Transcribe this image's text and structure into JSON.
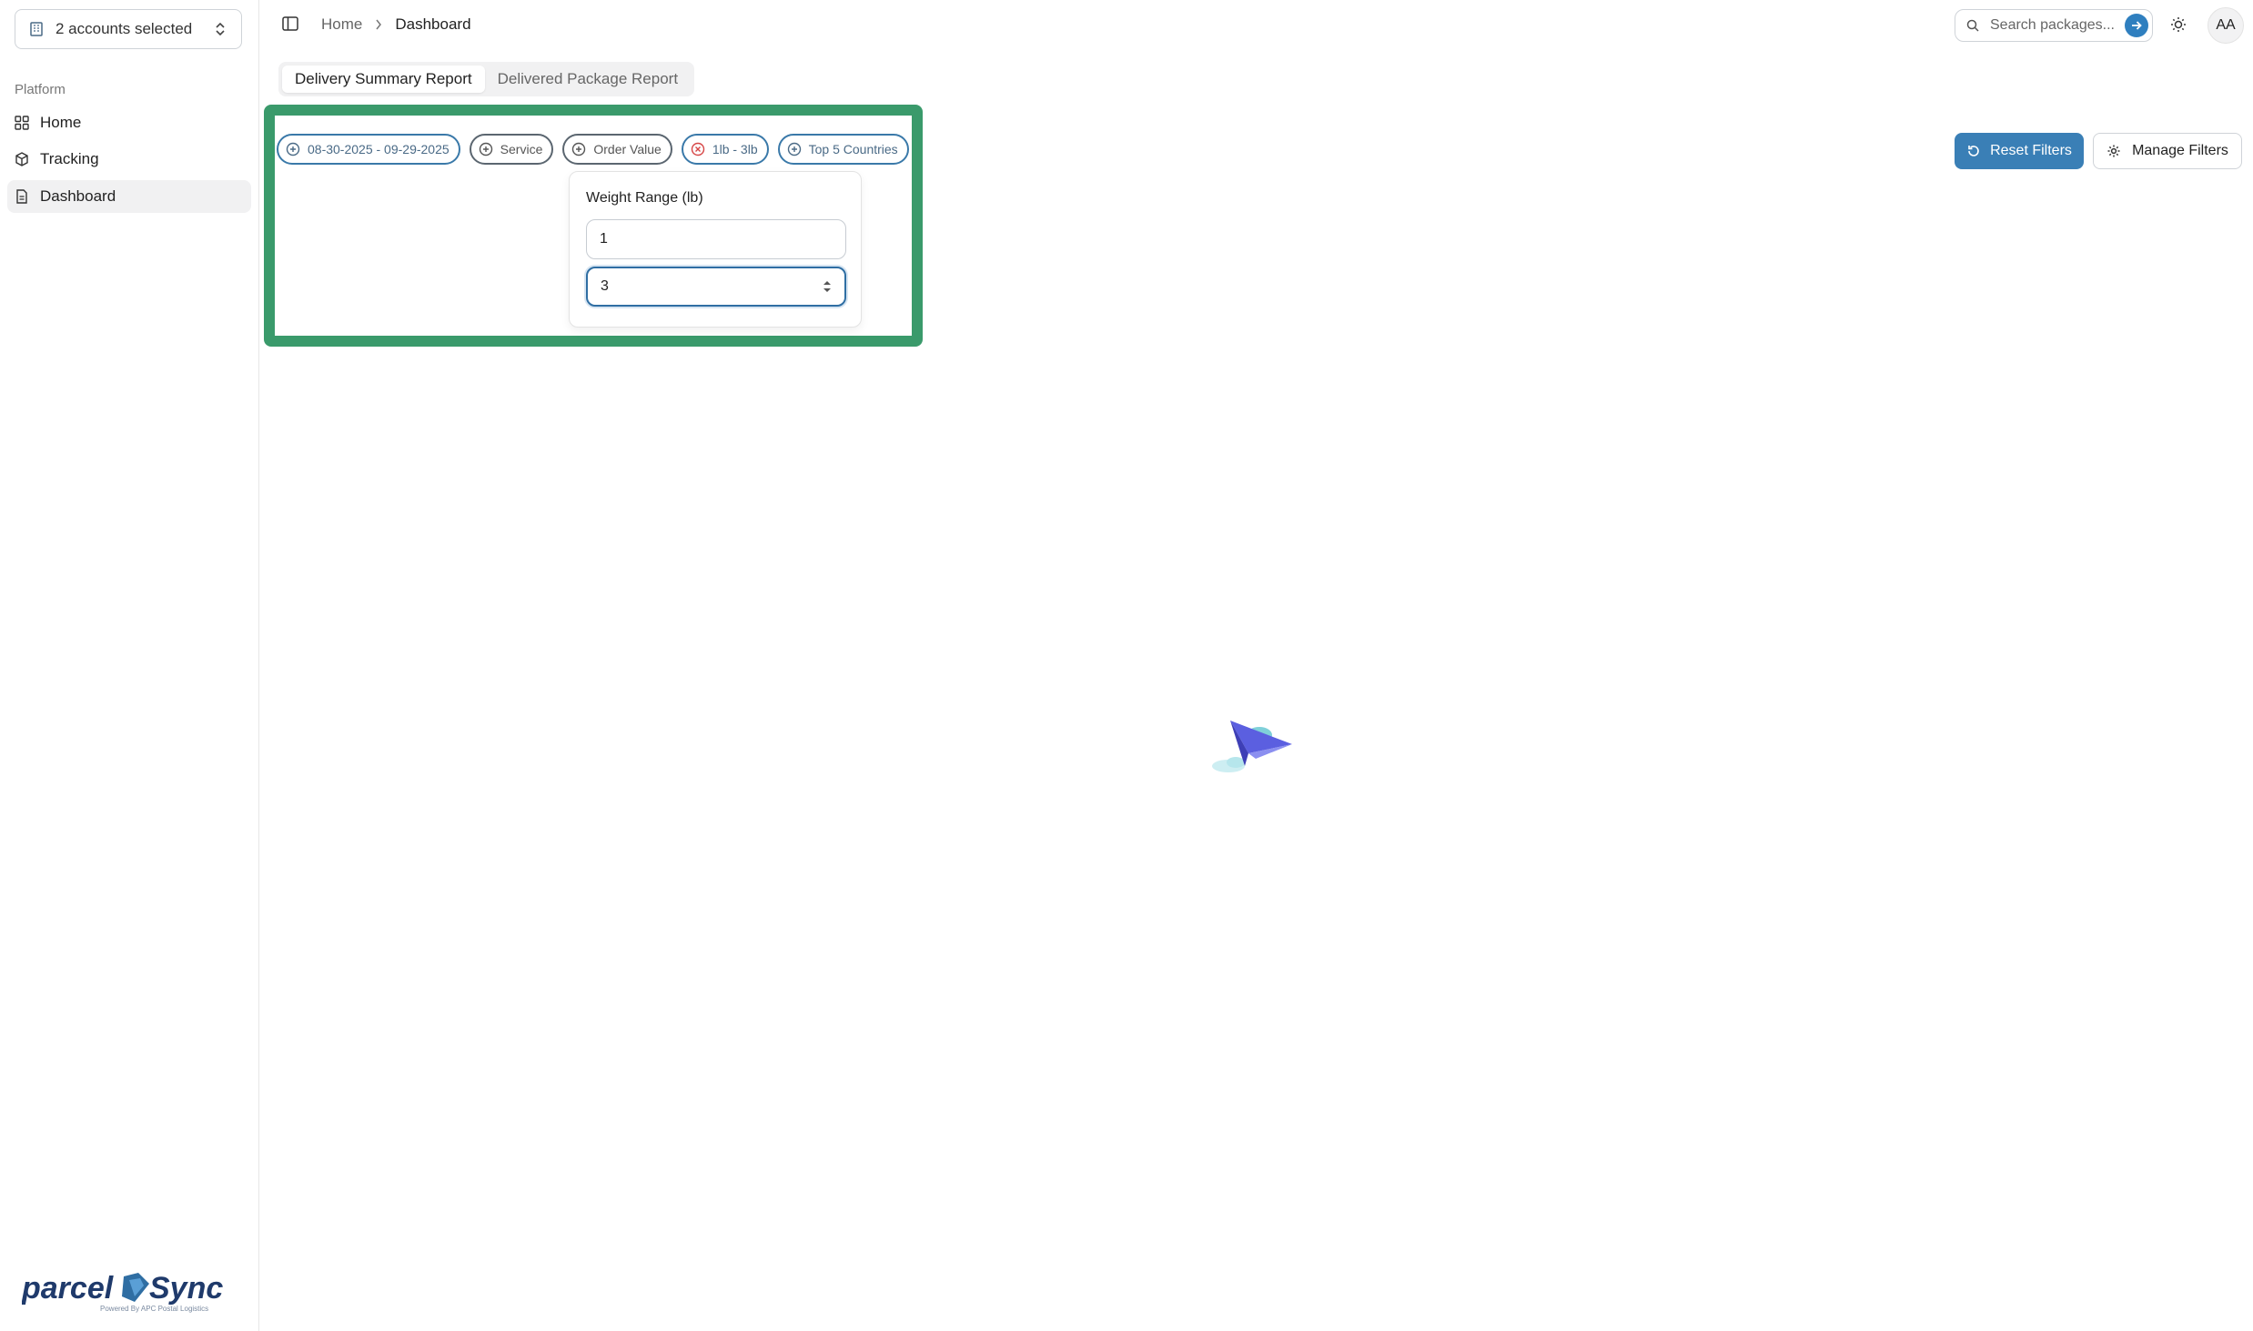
{
  "sidebar": {
    "account_selector": "2 accounts selected",
    "section_label": "Platform",
    "items": [
      {
        "label": "Home",
        "icon": "grid-icon"
      },
      {
        "label": "Tracking",
        "icon": "package-icon"
      },
      {
        "label": "Dashboard",
        "icon": "document-icon",
        "active": true
      }
    ],
    "logo_text": "parcelSync",
    "logo_tagline": "Powered By APC Postal Logistics"
  },
  "header": {
    "breadcrumb": {
      "home": "Home",
      "current": "Dashboard"
    },
    "search_placeholder": "Search packages...",
    "avatar_initials": "AA"
  },
  "tabs": [
    {
      "label": "Delivery Summary Report",
      "active": true
    },
    {
      "label": "Delivered Package Report",
      "active": false
    }
  ],
  "filters": {
    "chips": [
      {
        "label": "08-30-2025 - 09-29-2025",
        "icon": "plus-circle-icon"
      },
      {
        "label": "Service",
        "icon": "plus-circle-icon"
      },
      {
        "label": "Order Value",
        "icon": "plus-circle-icon"
      },
      {
        "label": "1lb - 3lb",
        "icon": "x-circle-icon"
      },
      {
        "label": "Top 5 Countries",
        "icon": "plus-circle-icon"
      }
    ],
    "weight_popover": {
      "title": "Weight Range (lb)",
      "min": "1",
      "max": "3"
    },
    "reset_label": "Reset Filters",
    "manage_label": "Manage Filters"
  },
  "colors": {
    "accent": "#3a7fb6",
    "highlight": "#3a9a6b",
    "error": "#d64545"
  }
}
